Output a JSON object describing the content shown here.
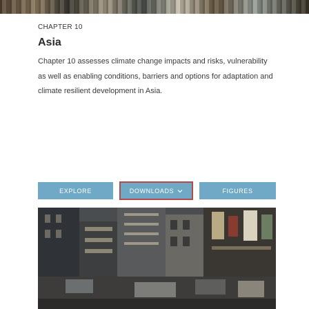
{
  "header": {
    "chapter": "CHAPTER 10",
    "title": "Asia"
  },
  "description": "Chapter 10 assesses climate change impacts and risks, vulnerability as well as enabling conditions, barriers and options for adaptation and climate resilient development in Asia.",
  "buttons": {
    "explore": "EXPLORE",
    "downloads": "DOWNLOADS",
    "figures": "FIGURES"
  },
  "colors": {
    "button_bg": "#6fa9c5",
    "focus_border": "#b44a4a"
  }
}
